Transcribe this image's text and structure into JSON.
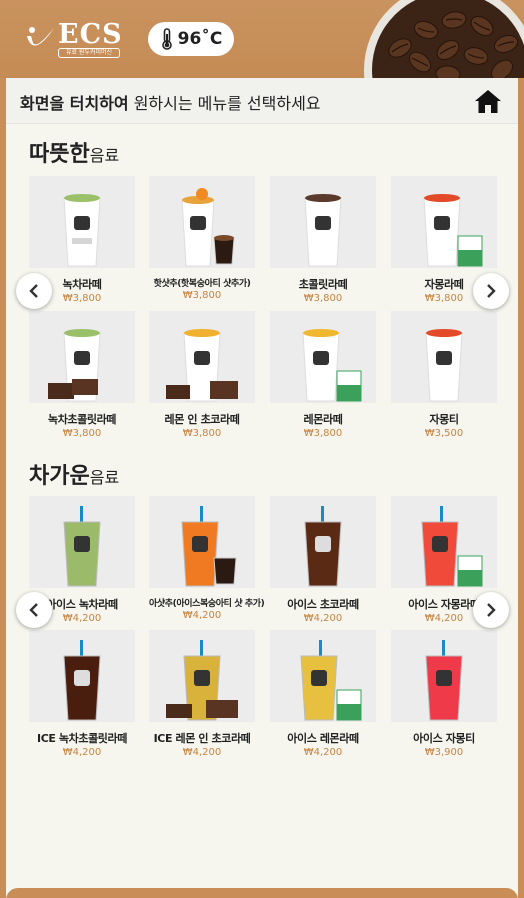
{
  "header": {
    "logo_text": "ECS",
    "logo_sub": "유료 원두커피머신",
    "temperature": "96˚C",
    "thermometer_icon": "thermometer-icon"
  },
  "instruction": {
    "bold": "화면을 터치하여",
    "rest": " 원하시는 메뉴를 선택하세요",
    "home_icon": "home-icon"
  },
  "hot": {
    "title_big": "따뜻한",
    "title_small": "음료",
    "items": [
      {
        "name": "녹차라떼",
        "price": "₩3,800"
      },
      {
        "name": "핫샷추(핫복숭아티 샷추가)",
        "price": "₩3,800"
      },
      {
        "name": "초콜릿라떼",
        "price": "₩3,800"
      },
      {
        "name": "자몽라떼",
        "price": "₩3,800"
      },
      {
        "name": "녹차초콜릿라떼",
        "price": "₩3,800"
      },
      {
        "name": "레몬 인 초코라떼",
        "price": "₩3,800"
      },
      {
        "name": "레몬라떼",
        "price": "₩3,800"
      },
      {
        "name": "자몽티",
        "price": "₩3,500"
      }
    ]
  },
  "cold": {
    "title_big": "차가운",
    "title_small": "음료",
    "items": [
      {
        "name": "아이스 녹차라떼",
        "price": "₩4,200"
      },
      {
        "name": "아샷추(아이스복숭아티 샷 추가)",
        "price": "₩4,200"
      },
      {
        "name": "아이스 초코라떼",
        "price": "₩4,200"
      },
      {
        "name": "아이스 자몽라떼",
        "price": "₩4,200"
      },
      {
        "name": "ICE 녹차초콜릿라떼",
        "price": "₩4,200"
      },
      {
        "name": "ICE 레몬 인 초코라떼",
        "price": "₩4,200"
      },
      {
        "name": "아이스 레몬라떼",
        "price": "₩4,200"
      },
      {
        "name": "아이스 자몽티",
        "price": "₩3,900"
      }
    ]
  },
  "colors": {
    "brand": "#c98e58",
    "price": "#c68442",
    "panel": "#f6f6ef"
  }
}
